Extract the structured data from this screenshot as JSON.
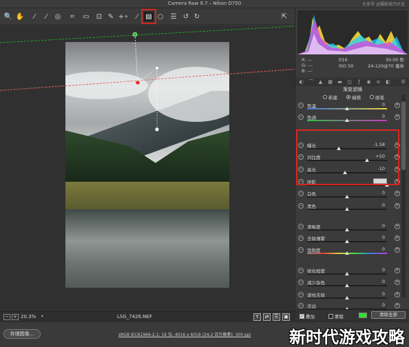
{
  "window": {
    "title": "Camera Raw 9.7 – Nikon D750",
    "watermark": "头条号 @摄影技巧大全"
  },
  "toolbar": {
    "tools": [
      {
        "name": "zoom-tool",
        "glyph": "🔍"
      },
      {
        "name": "hand-tool",
        "glyph": "✋"
      },
      {
        "name": "white-balance-tool",
        "glyph": "⁄"
      },
      {
        "name": "color-sampler-tool",
        "glyph": "⁄"
      },
      {
        "name": "targeted-adjustment-tool",
        "glyph": "◎"
      },
      {
        "name": "crop-tool",
        "glyph": "⌗"
      },
      {
        "name": "straighten-tool",
        "glyph": "▭"
      },
      {
        "name": "transform-tool",
        "glyph": "⊡"
      },
      {
        "name": "spot-removal-tool",
        "glyph": "✎"
      },
      {
        "name": "red-eye-tool",
        "glyph": "+∘"
      },
      {
        "name": "adjustment-brush-tool",
        "glyph": "⁄"
      },
      {
        "name": "graduated-filter-tool",
        "glyph": "▤"
      },
      {
        "name": "radial-filter-tool",
        "glyph": "○"
      },
      {
        "name": "preferences",
        "glyph": "☰"
      },
      {
        "name": "rotate-left",
        "glyph": "↺"
      },
      {
        "name": "rotate-right",
        "glyph": "↻"
      }
    ],
    "export_glyph": "⇱"
  },
  "status": {
    "zoom": "20.3%",
    "zoom_minus": "−",
    "zoom_plus": "+",
    "filename": "LSG_7426.NEF",
    "y_label": "Y",
    "b_label": "B"
  },
  "footer": {
    "save_label": "存储图像...",
    "workflow_info": "sRGB IEC61966-2.1; 16 位; 4016 x 6016 (24.2 百万像素); 300 ppi",
    "overlay_text": "新时代游戏攻略"
  },
  "readout": {
    "rgb": [
      "R:",
      "G:",
      "B:"
    ],
    "rgb_values": [
      "---",
      "---",
      "---"
    ],
    "aperture": "f/16",
    "shutter": "30.00 秒",
    "iso": "ISO 50",
    "lens": "24-120@70 毫米"
  },
  "panel": {
    "title": "渐变滤镜",
    "modes": [
      {
        "label": "新建",
        "selected": false
      },
      {
        "label": "编辑",
        "selected": true
      },
      {
        "label": "画笔",
        "selected": false
      }
    ],
    "sliders": [
      {
        "label": "色温",
        "value": "0",
        "pos": 0.5,
        "track": "temp"
      },
      {
        "label": "色调",
        "value": "0",
        "pos": 0.5,
        "track": "tint"
      },
      {
        "label": "曝光",
        "value": "-1.58",
        "pos": 0.4,
        "track": "plain"
      },
      {
        "label": "对比度",
        "value": "+50",
        "pos": 0.75,
        "track": "plain"
      },
      {
        "label": "高光",
        "value": "-10",
        "pos": 0.47,
        "track": "plain"
      },
      {
        "label": "阴影",
        "value": "",
        "pos": 1.0,
        "track": "plain",
        "swatch": true
      },
      {
        "label": "白色",
        "value": "0",
        "pos": 0.5,
        "track": "plain"
      },
      {
        "label": "黑色",
        "value": "0",
        "pos": 0.5,
        "track": "plain"
      },
      {
        "label": "清晰度",
        "value": "0",
        "pos": 0.5,
        "track": "plain"
      },
      {
        "label": "去除薄雾",
        "value": "0",
        "pos": 0.5,
        "track": "plain"
      },
      {
        "label": "饱和度",
        "value": "0",
        "pos": 0.5,
        "track": "sat"
      },
      {
        "label": "锐化程度",
        "value": "0",
        "pos": 0.5,
        "track": "plain"
      },
      {
        "label": "减少杂色",
        "value": "0",
        "pos": 0.5,
        "track": "plain"
      },
      {
        "label": "波纹去除",
        "value": "0",
        "pos": 0.5,
        "track": "plain"
      },
      {
        "label": "去边",
        "value": "0",
        "pos": 0.5,
        "track": "plain"
      }
    ],
    "overlay_label": "叠加",
    "mask_label": "蒙版",
    "mask_color": "#2ee12e",
    "clear_label": "清除全部"
  },
  "colors": {
    "accent_red": "#d8261c",
    "guide_green": "#25c425",
    "guide_red": "#e0342a"
  }
}
